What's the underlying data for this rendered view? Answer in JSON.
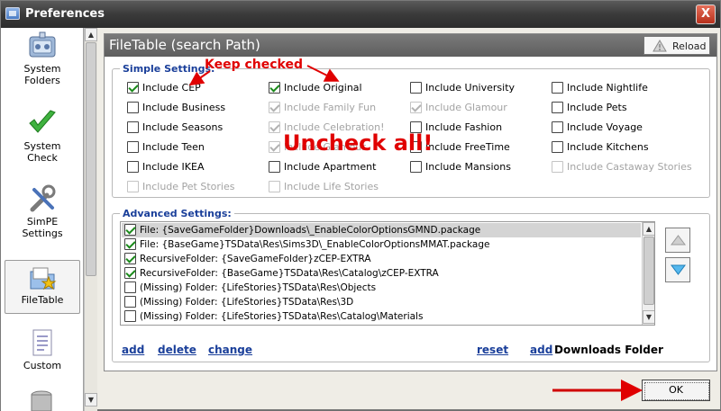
{
  "window": {
    "title": "Preferences",
    "close_label": "X"
  },
  "sidebar": {
    "items": [
      {
        "label_line1": "System",
        "label_line2": "Folders",
        "icon": "folders-icon"
      },
      {
        "label_line1": "System",
        "label_line2": "Check",
        "icon": "checkmark-icon"
      },
      {
        "label_line1": "SimPE",
        "label_line2": "Settings",
        "icon": "tools-icon"
      },
      {
        "label_line1": "FileTable",
        "label_line2": "",
        "icon": "filetable-icon",
        "selected": true
      },
      {
        "label_line1": "Custom",
        "label_line2": "",
        "icon": "custom-icon"
      }
    ]
  },
  "panel": {
    "title": "FileTable (search Path)",
    "reload_label": "Reload",
    "simple_settings": {
      "title": "Simple Settings:",
      "columns": [
        [
          {
            "label": "Include CEP",
            "checked": true,
            "disabled": false
          },
          {
            "label": "Include Business",
            "checked": false,
            "disabled": false
          },
          {
            "label": "Include Seasons",
            "checked": false,
            "disabled": false
          },
          {
            "label": "Include Teen",
            "checked": false,
            "disabled": false
          },
          {
            "label": "Include IKEA",
            "checked": false,
            "disabled": false
          },
          {
            "label": "Include Pet Stories",
            "checked": false,
            "disabled": true
          }
        ],
        [
          {
            "label": "Include Original",
            "checked": true,
            "disabled": false
          },
          {
            "label": "Include Family Fun",
            "checked": true,
            "disabled": true
          },
          {
            "label": "Include Celebration!",
            "checked": true,
            "disabled": true
          },
          {
            "label": "Include Glamour",
            "checked": true,
            "disabled": true
          },
          {
            "label": "Include Apartment",
            "checked": false,
            "disabled": false
          },
          {
            "label": "Include Life Stories",
            "checked": false,
            "disabled": true
          }
        ],
        [
          {
            "label": "Include University",
            "checked": false,
            "disabled": false
          },
          {
            "label": "Include Glamour",
            "checked": true,
            "disabled": true
          },
          {
            "label": "Include Fashion",
            "checked": false,
            "disabled": false
          },
          {
            "label": "Include FreeTime",
            "checked": false,
            "disabled": false
          },
          {
            "label": "Include Mansions",
            "checked": false,
            "disabled": false
          }
        ],
        [
          {
            "label": "Include Nightlife",
            "checked": false,
            "disabled": false
          },
          {
            "label": "Include Pets",
            "checked": false,
            "disabled": false
          },
          {
            "label": "Include Voyage",
            "checked": false,
            "disabled": false
          },
          {
            "label": "Include Kitchens",
            "checked": false,
            "disabled": false
          },
          {
            "label": "Include Castaway Stories",
            "checked": false,
            "disabled": true
          }
        ]
      ]
    },
    "advanced_settings": {
      "title": "Advanced Settings:",
      "rows": [
        {
          "text": "File:  {SaveGameFolder}Downloads\\_EnableColorOptionsGMND.package",
          "checked": true,
          "selected": true
        },
        {
          "text": "File:  {BaseGame}TSData\\Res\\Sims3D\\_EnableColorOptionsMMAT.package",
          "checked": true,
          "selected": false
        },
        {
          "text": "RecursiveFolder: {SaveGameFolder}zCEP-EXTRA",
          "checked": true,
          "selected": false
        },
        {
          "text": "RecursiveFolder: {BaseGame}TSData\\Res\\Catalog\\zCEP-EXTRA",
          "checked": true,
          "selected": false
        },
        {
          "text": "(Missing) Folder: {LifeStories}TSData\\Res\\Objects",
          "checked": false,
          "selected": false
        },
        {
          "text": "(Missing) Folder: {LifeStories}TSData\\Res\\3D",
          "checked": false,
          "selected": false
        },
        {
          "text": "(Missing) Folder: {LifeStories}TSData\\Res\\Catalog\\Materials",
          "checked": false,
          "selected": false
        }
      ],
      "links": {
        "add": "add",
        "delete": "delete",
        "change": "change",
        "reset": "reset",
        "add2": "add",
        "downloads_folder": "Downloads Folder"
      }
    }
  },
  "ok_label": "OK",
  "annotations": {
    "keep_checked": "Keep checked",
    "uncheck_all": "Uncheck all!",
    "color": "#e00000"
  },
  "colors": {
    "accent_blue": "#1a3f9a",
    "header_gray": "#6a6a6a",
    "check_green": "#1a8a1a"
  }
}
